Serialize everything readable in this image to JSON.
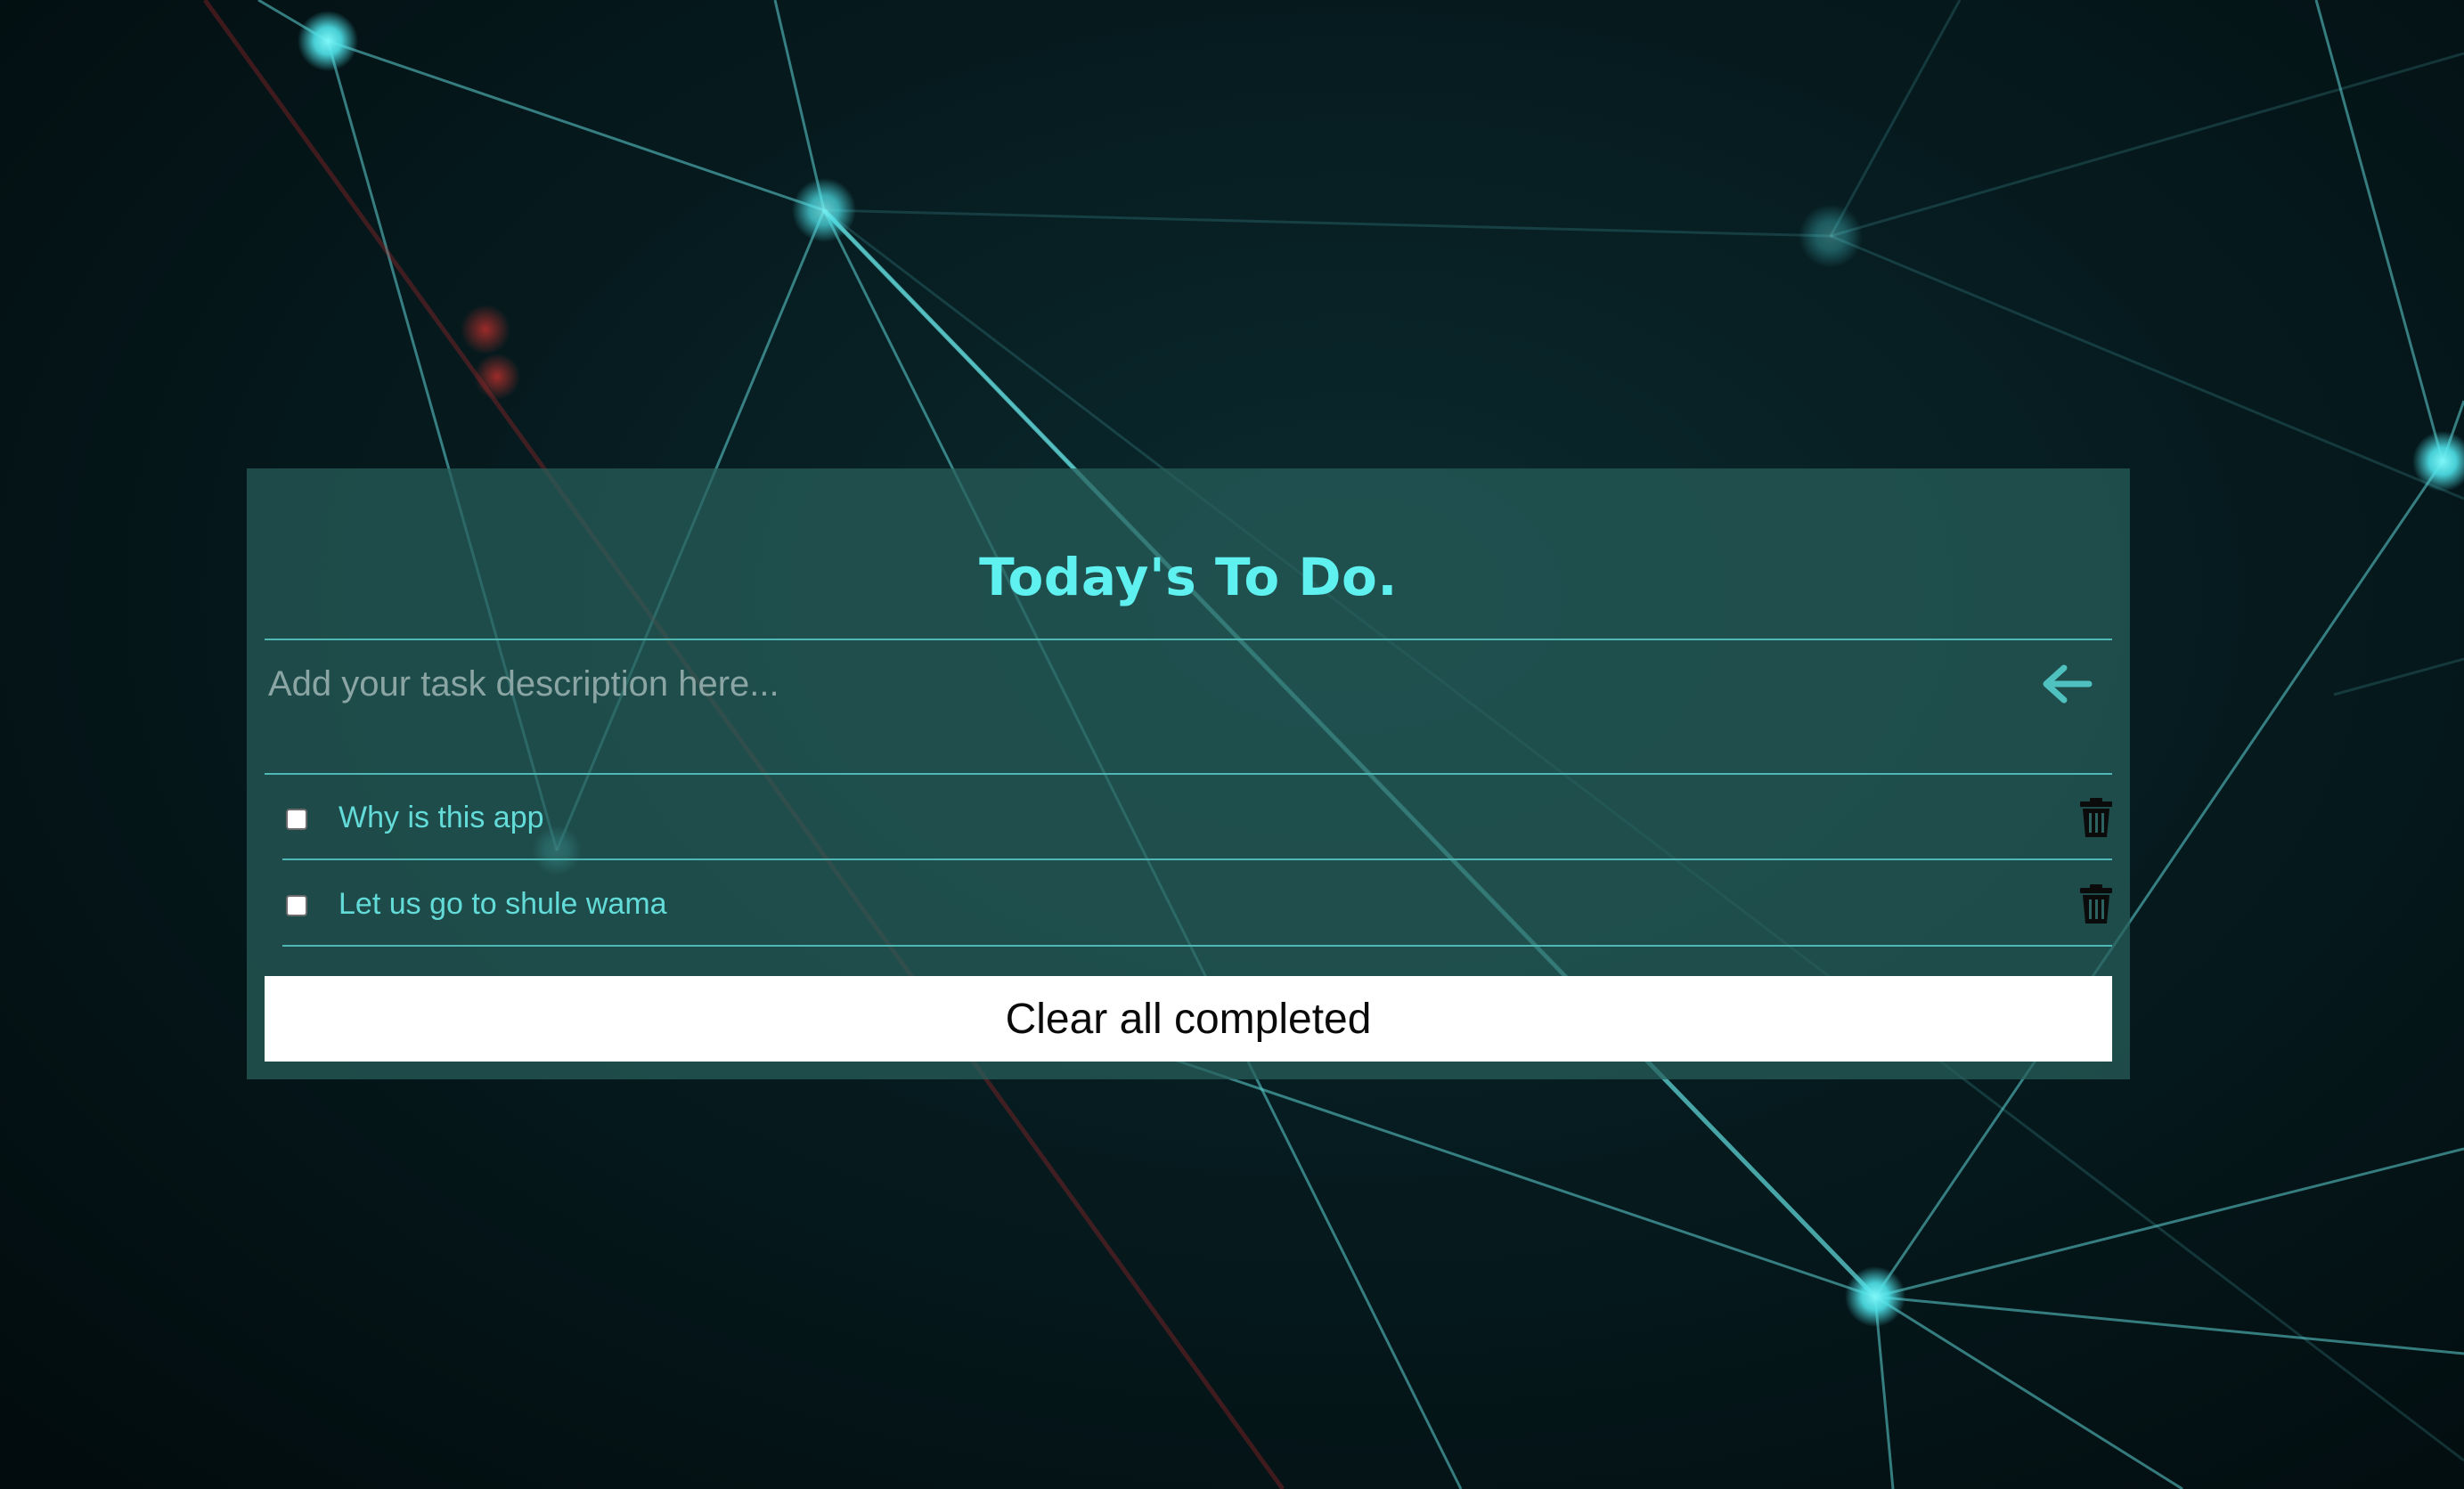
{
  "app": {
    "title": "Today's To Do."
  },
  "input": {
    "placeholder": "Add your task description here...",
    "value": "",
    "submit_icon": "arrow-left-icon"
  },
  "tasks": [
    {
      "label": "Why is this app",
      "completed": false,
      "delete_icon": "trash-icon"
    },
    {
      "label": "Let us go to shule wama",
      "completed": false,
      "delete_icon": "trash-icon"
    }
  ],
  "clear_button": {
    "label": "Clear all completed"
  },
  "colors": {
    "accent": "#5ff0f0",
    "task_text": "#63dbd8",
    "card_bg": "#285f5c",
    "divider": "#4fb8b4",
    "page_bg": "#031316"
  }
}
